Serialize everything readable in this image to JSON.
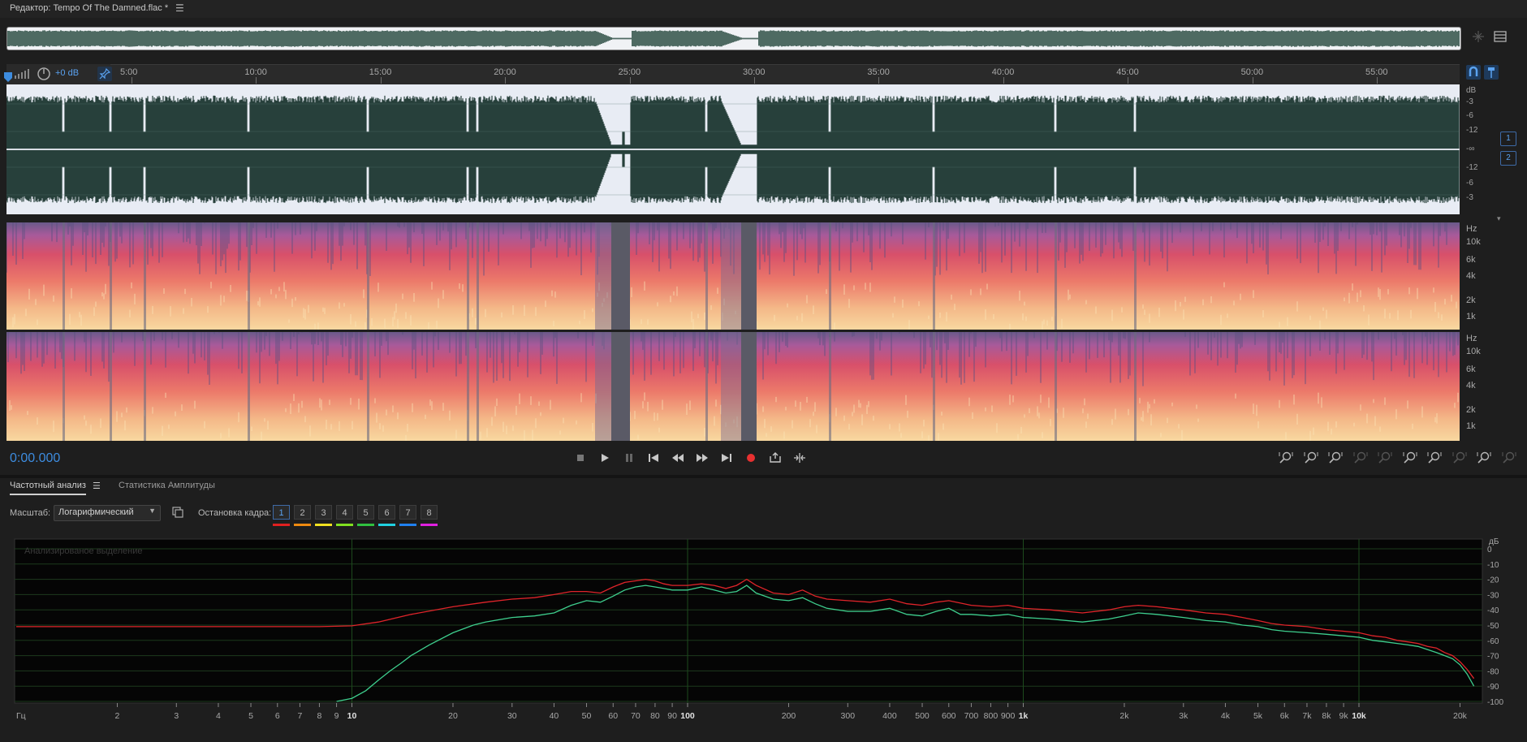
{
  "editor": {
    "title": "Редактор: Tempo Of The Damned.flac *",
    "menu_icon": "hamburger-menu-icon"
  },
  "ruler": {
    "gain": "+0 dB",
    "ticks": [
      "5:00",
      "10:00",
      "15:00",
      "20:00",
      "25:00",
      "30:00",
      "35:00",
      "40:00",
      "45:00",
      "50:00",
      "55:00"
    ]
  },
  "waveform": {
    "db_labels": [
      "dB",
      "-3",
      "-6",
      "-12",
      "-∞",
      "-12",
      "-6",
      "-3"
    ],
    "channels": [
      "1",
      "2"
    ]
  },
  "spectrogram": {
    "hz_labels": [
      "Hz",
      "10k",
      "6k",
      "4k",
      "2k",
      "1k"
    ]
  },
  "transport": {
    "time": "0:00.000",
    "buttons": [
      "stop-icon",
      "play-icon",
      "pause-icon",
      "go-to-start-icon",
      "rewind-icon",
      "fast-forward-icon",
      "go-to-end-icon",
      "record-icon",
      "loop-playback-icon",
      "skip-selection-icon"
    ]
  },
  "zoom_tools": [
    "zoom-in-amplitude-icon",
    "zoom-out-amplitude-icon",
    "zoom-in-time-icon",
    "zoom-out-time-icon",
    "zoom-full-icon",
    "zoom-in-left-icon",
    "zoom-in-right-icon",
    "zoom-selection-icon",
    "zoom-reset-icon",
    "zoom-extra-icon"
  ],
  "analysis": {
    "tabs": [
      {
        "label": "Частотный анализ",
        "active": true
      },
      {
        "label": "Статистика Амплитуды",
        "active": false
      }
    ],
    "scale_label": "Масштаб:",
    "scale_value": "Логарифмический",
    "freeze_label": "Остановка кадра:",
    "frames": [
      {
        "label": "1",
        "color": "#e02020",
        "active": true
      },
      {
        "label": "2",
        "color": "#ee8a10",
        "active": false
      },
      {
        "label": "3",
        "color": "#f0e020",
        "active": false
      },
      {
        "label": "4",
        "color": "#80e020",
        "active": false
      },
      {
        "label": "5",
        "color": "#30c040",
        "active": false
      },
      {
        "label": "6",
        "color": "#20d0e0",
        "active": false
      },
      {
        "label": "7",
        "color": "#2080f0",
        "active": false
      },
      {
        "label": "8",
        "color": "#e020e0",
        "active": false
      }
    ],
    "watermark": "Анализированое выделение"
  },
  "chart_data": {
    "type": "line",
    "x_scale": "log",
    "xlim": [
      1,
      22050
    ],
    "ylim": [
      -100,
      0
    ],
    "ylabel": "дБ",
    "x_unit_label": "Гц",
    "x_ticks": [
      {
        "v": 2,
        "l": "2"
      },
      {
        "v": 3,
        "l": "3"
      },
      {
        "v": 4,
        "l": "4"
      },
      {
        "v": 5,
        "l": "5"
      },
      {
        "v": 6,
        "l": "6"
      },
      {
        "v": 7,
        "l": "7"
      },
      {
        "v": 8,
        "l": "8"
      },
      {
        "v": 9,
        "l": "9"
      },
      {
        "v": 10,
        "l": "10",
        "major": true
      },
      {
        "v": 20,
        "l": "20"
      },
      {
        "v": 30,
        "l": "30"
      },
      {
        "v": 40,
        "l": "40"
      },
      {
        "v": 50,
        "l": "50"
      },
      {
        "v": 60,
        "l": "60"
      },
      {
        "v": 70,
        "l": "70"
      },
      {
        "v": 80,
        "l": "80"
      },
      {
        "v": 90,
        "l": "90"
      },
      {
        "v": 100,
        "l": "100",
        "major": true
      },
      {
        "v": 200,
        "l": "200"
      },
      {
        "v": 300,
        "l": "300"
      },
      {
        "v": 400,
        "l": "400"
      },
      {
        "v": 500,
        "l": "500"
      },
      {
        "v": 600,
        "l": "600"
      },
      {
        "v": 700,
        "l": "700"
      },
      {
        "v": 800,
        "l": "800"
      },
      {
        "v": 900,
        "l": "900"
      },
      {
        "v": 1000,
        "l": "1k",
        "major": true
      },
      {
        "v": 2000,
        "l": "2k"
      },
      {
        "v": 3000,
        "l": "3k"
      },
      {
        "v": 4000,
        "l": "4k"
      },
      {
        "v": 5000,
        "l": "5k"
      },
      {
        "v": 6000,
        "l": "6k"
      },
      {
        "v": 7000,
        "l": "7k"
      },
      {
        "v": 8000,
        "l": "8k"
      },
      {
        "v": 9000,
        "l": "9k"
      },
      {
        "v": 10000,
        "l": "10k",
        "major": true
      },
      {
        "v": 20000,
        "l": "20k"
      }
    ],
    "y_ticks": [
      0,
      -10,
      -20,
      -30,
      -40,
      -50,
      -60,
      -70,
      -80,
      -90,
      -100
    ],
    "series": [
      {
        "color": "#e0242a",
        "points": [
          [
            1,
            -51
          ],
          [
            5,
            -51
          ],
          [
            8,
            -51
          ],
          [
            10,
            -50.5
          ],
          [
            12,
            -48
          ],
          [
            15,
            -43
          ],
          [
            20,
            -38
          ],
          [
            25,
            -35
          ],
          [
            30,
            -33
          ],
          [
            35,
            -32
          ],
          [
            40,
            -30
          ],
          [
            45,
            -28
          ],
          [
            50,
            -28
          ],
          [
            55,
            -29
          ],
          [
            60,
            -25
          ],
          [
            65,
            -22
          ],
          [
            70,
            -21
          ],
          [
            75,
            -20
          ],
          [
            80,
            -21
          ],
          [
            85,
            -23
          ],
          [
            90,
            -24
          ],
          [
            100,
            -24
          ],
          [
            110,
            -23
          ],
          [
            120,
            -24
          ],
          [
            130,
            -26
          ],
          [
            140,
            -24
          ],
          [
            150,
            -20
          ],
          [
            160,
            -24
          ],
          [
            180,
            -29
          ],
          [
            200,
            -30
          ],
          [
            220,
            -27
          ],
          [
            240,
            -31
          ],
          [
            260,
            -33
          ],
          [
            300,
            -34
          ],
          [
            350,
            -35
          ],
          [
            400,
            -33
          ],
          [
            450,
            -36
          ],
          [
            500,
            -37
          ],
          [
            550,
            -35
          ],
          [
            600,
            -34
          ],
          [
            700,
            -37
          ],
          [
            800,
            -38
          ],
          [
            900,
            -37
          ],
          [
            1000,
            -39
          ],
          [
            1200,
            -40
          ],
          [
            1500,
            -42
          ],
          [
            1800,
            -40
          ],
          [
            2000,
            -38
          ],
          [
            2200,
            -37
          ],
          [
            2500,
            -38
          ],
          [
            3000,
            -40
          ],
          [
            3500,
            -42
          ],
          [
            4000,
            -43
          ],
          [
            4500,
            -45
          ],
          [
            5000,
            -47
          ],
          [
            5500,
            -49
          ],
          [
            6000,
            -50
          ],
          [
            7000,
            -51
          ],
          [
            8000,
            -53
          ],
          [
            9000,
            -54
          ],
          [
            10000,
            -55
          ],
          [
            11000,
            -57
          ],
          [
            12000,
            -58
          ],
          [
            13000,
            -60
          ],
          [
            14000,
            -61
          ],
          [
            15000,
            -62
          ],
          [
            16000,
            -64
          ],
          [
            17000,
            -65
          ],
          [
            18000,
            -68
          ],
          [
            19000,
            -70
          ],
          [
            20000,
            -74
          ],
          [
            21000,
            -79
          ],
          [
            22000,
            -85
          ]
        ]
      },
      {
        "color": "#3ecf8e",
        "points": [
          [
            9,
            -100
          ],
          [
            10,
            -98
          ],
          [
            11,
            -93
          ],
          [
            12,
            -86
          ],
          [
            13,
            -80
          ],
          [
            14,
            -75
          ],
          [
            15,
            -70
          ],
          [
            17,
            -63
          ],
          [
            20,
            -55
          ],
          [
            23,
            -50
          ],
          [
            25,
            -48
          ],
          [
            30,
            -45
          ],
          [
            35,
            -44
          ],
          [
            40,
            -42
          ],
          [
            45,
            -37
          ],
          [
            50,
            -34
          ],
          [
            55,
            -35
          ],
          [
            60,
            -31
          ],
          [
            65,
            -27
          ],
          [
            70,
            -25
          ],
          [
            75,
            -24
          ],
          [
            80,
            -25
          ],
          [
            85,
            -26
          ],
          [
            90,
            -27
          ],
          [
            100,
            -27
          ],
          [
            110,
            -25
          ],
          [
            120,
            -27
          ],
          [
            130,
            -29
          ],
          [
            140,
            -28
          ],
          [
            150,
            -24
          ],
          [
            160,
            -29
          ],
          [
            180,
            -33
          ],
          [
            200,
            -34
          ],
          [
            220,
            -32
          ],
          [
            240,
            -36
          ],
          [
            260,
            -39
          ],
          [
            300,
            -41
          ],
          [
            350,
            -41
          ],
          [
            400,
            -39
          ],
          [
            450,
            -43
          ],
          [
            500,
            -44
          ],
          [
            550,
            -41
          ],
          [
            600,
            -39
          ],
          [
            650,
            -43
          ],
          [
            700,
            -43
          ],
          [
            800,
            -44
          ],
          [
            900,
            -43
          ],
          [
            1000,
            -45
          ],
          [
            1200,
            -46
          ],
          [
            1500,
            -48
          ],
          [
            1800,
            -46
          ],
          [
            2000,
            -44
          ],
          [
            2200,
            -42
          ],
          [
            2500,
            -43
          ],
          [
            3000,
            -45
          ],
          [
            3500,
            -47
          ],
          [
            4000,
            -48
          ],
          [
            4500,
            -50
          ],
          [
            5000,
            -51
          ],
          [
            5500,
            -53
          ],
          [
            6000,
            -54
          ],
          [
            7000,
            -55
          ],
          [
            8000,
            -56
          ],
          [
            9000,
            -57
          ],
          [
            10000,
            -58
          ],
          [
            11000,
            -60
          ],
          [
            12000,
            -61
          ],
          [
            13000,
            -62
          ],
          [
            14000,
            -63
          ],
          [
            15000,
            -64
          ],
          [
            16000,
            -66
          ],
          [
            17000,
            -68
          ],
          [
            18000,
            -70
          ],
          [
            19000,
            -72
          ],
          [
            20000,
            -76
          ],
          [
            21000,
            -82
          ],
          [
            22000,
            -90
          ]
        ]
      }
    ]
  }
}
